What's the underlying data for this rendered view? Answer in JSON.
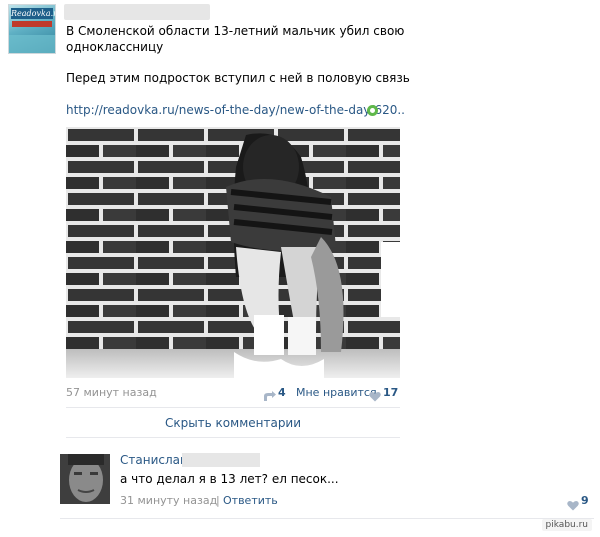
{
  "post": {
    "source_logo_text": "Readovka.ru",
    "headline_line1": "В Смоленской области 13-летний мальчик убил свою",
    "headline_line2": "одноклассницу",
    "subtext": "Перед этим подросток вступил с ней в половую связь",
    "link": "http://readovka.ru/news-of-the-day/new-of-the-day/620..",
    "time": "57 минут назад",
    "reposts": "4",
    "likes_label": "Мне нравится",
    "likes_count": "17",
    "hide_comments": "Скрыть комментарии"
  },
  "comment": {
    "author": "Станислав",
    "text": "а что делал я в 13 лет? ел песок...",
    "time": "31 минуту назад",
    "separator": "|",
    "reply": "Ответить",
    "likes": "9"
  },
  "watermark": "pikabu.ru",
  "colors": {
    "link": "#2a5885",
    "meta": "#939393",
    "divider": "#e7e8ec",
    "link_icon": "#5fb84a"
  }
}
